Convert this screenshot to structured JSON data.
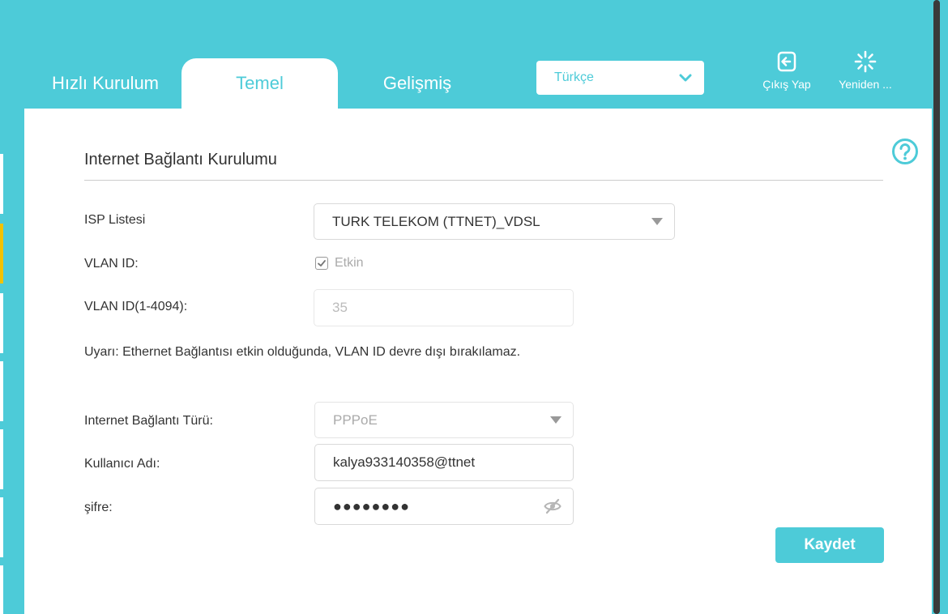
{
  "nav": {
    "tabs": [
      {
        "label": "Hızlı Kurulum"
      },
      {
        "label": "Temel"
      },
      {
        "label": "Gelişmiş"
      }
    ]
  },
  "language": {
    "selected": "Türkçe"
  },
  "actions": {
    "logout_label": "Çıkış Yap",
    "reboot_label": "Yeniden ..."
  },
  "section": {
    "title": "Internet Bağlantı Kurulumu"
  },
  "form": {
    "isp_label": "ISP Listesi",
    "isp_value": "TURK TELEKOM (TTNET)_VDSL",
    "vlan_label": "VLAN ID:",
    "vlan_checkbox_label": "Etkin",
    "vlan_id_label": "VLAN ID(1-4094):",
    "vlan_id_value": "35",
    "warning": "Uyarı: Ethernet Bağlantısı etkin olduğunda, VLAN ID devre dışı bırakılamaz.",
    "conn_type_label": "Internet Bağlantı Türü:",
    "conn_type_value": "PPPoE",
    "username_label": "Kullanıcı Adı:",
    "username_value": "kalya933140358@ttnet",
    "password_label": "şifre:",
    "password_mask": "●●●●●●●●",
    "save_label": "Kaydet"
  },
  "colors": {
    "brand": "#4dcbd8",
    "active_indicator": "#f2c200"
  },
  "icons": {
    "logout": "logout-icon",
    "reboot": "reboot-icon",
    "help": "help-icon",
    "eye": "eye-off-icon",
    "chevron": "chevron-down-icon"
  }
}
